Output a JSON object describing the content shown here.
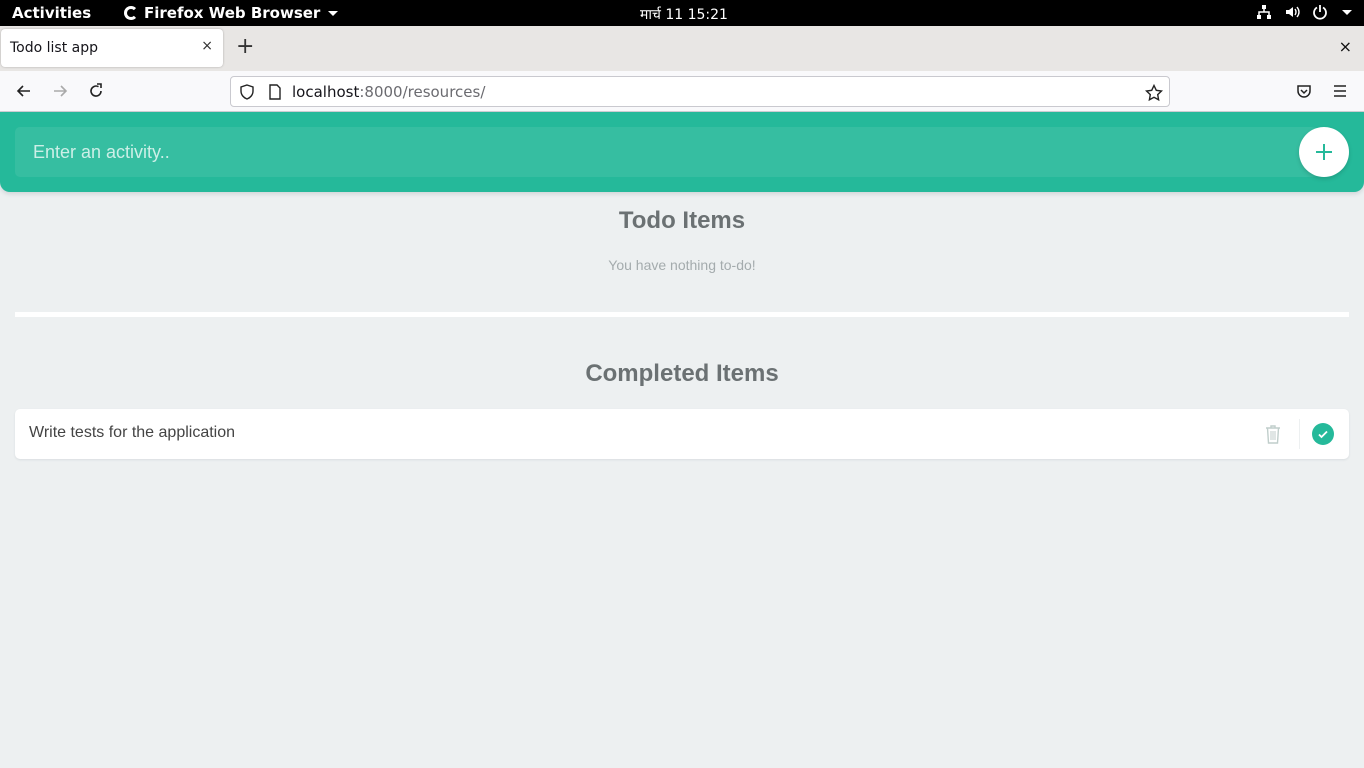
{
  "system_bar": {
    "activities": "Activities",
    "app_name": "Firefox Web Browser",
    "clock": "मार्च 11  15:21",
    "icons": [
      "network-icon",
      "volume-icon",
      "power-icon",
      "chevron-down-icon"
    ]
  },
  "browser": {
    "tab_title": "Todo list app",
    "tab_close": "×",
    "new_tab": "+",
    "window_close": "×",
    "url_host": "localhost",
    "url_rest": ":8000/resources/"
  },
  "app": {
    "input_placeholder": "Enter an activity..",
    "todo_title": "Todo Items",
    "empty_message": "You have nothing to-do!",
    "completed_title": "Completed Items",
    "completed_items": [
      {
        "text": "Write tests for the application"
      }
    ]
  },
  "colors": {
    "accent": "#25b99a",
    "page_background": "#edf0f1"
  }
}
